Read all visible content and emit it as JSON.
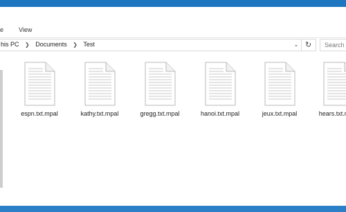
{
  "ribbon": {
    "tabs": [
      "e",
      "View"
    ]
  },
  "address": {
    "crumbs": [
      "his PC",
      "Documents",
      "Test"
    ],
    "dropdown_icon": "chevron-down-icon",
    "refresh_icon": "refresh-icon"
  },
  "search": {
    "placeholder": "Search T"
  },
  "files": [
    {
      "name": "espn.txt.mpal"
    },
    {
      "name": "kathy.txt.mpal"
    },
    {
      "name": "gregg.txt.mpal"
    },
    {
      "name": "hanoi.txt.mpal"
    },
    {
      "name": "jeux.txt.mpal"
    },
    {
      "name": "hears.txt.mpal"
    }
  ],
  "colors": {
    "desktop_blue": "#1a6fb8",
    "window_bg": "#ffffff"
  }
}
